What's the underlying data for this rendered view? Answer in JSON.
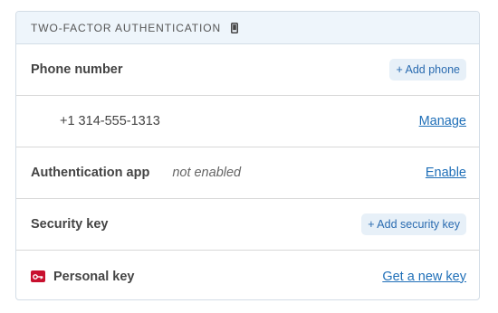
{
  "header": {
    "title": "TWO-FACTOR AUTHENTICATION",
    "icon": "mobile-phone-icon"
  },
  "rows": {
    "phone": {
      "label": "Phone number",
      "action_label": "+ Add phone"
    },
    "phone_entry": {
      "value": "+1 314-555-1313",
      "action_label": "Manage"
    },
    "auth_app": {
      "label": "Authentication app",
      "status": "not enabled",
      "action_label": "Enable"
    },
    "security_key": {
      "label": "Security key",
      "action_label": "+ Add security key"
    },
    "personal_key": {
      "label": "Personal key",
      "icon": "key-icon",
      "action_label": "Get a new key"
    }
  },
  "colors": {
    "header_bg": "#eef5fb",
    "border": "#d3dde6",
    "link": "#1f6fb8",
    "pill_bg": "#e7f0f8",
    "key_icon_bg": "#c8102e"
  }
}
